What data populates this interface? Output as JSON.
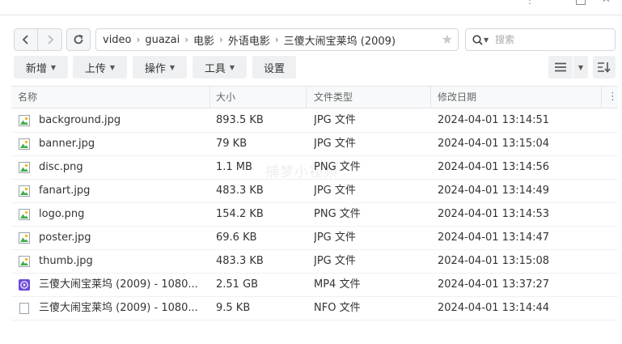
{
  "path": [
    "video",
    "guazai",
    "电影",
    "外语电影",
    "三傻大闹宝莱坞 (2009)"
  ],
  "search": {
    "placeholder": "搜索"
  },
  "toolbar": {
    "new": "新增",
    "upload": "上传",
    "action": "操作",
    "tools": "工具",
    "settings": "设置"
  },
  "columns": {
    "name": "名称",
    "size": "大小",
    "type": "文件类型",
    "modified": "修改日期"
  },
  "files": [
    {
      "name": "background.jpg",
      "size": "893.5 KB",
      "type": "JPG 文件",
      "modified": "2024-04-01 13:14:51",
      "icon": "image-file-icon"
    },
    {
      "name": "banner.jpg",
      "size": "79 KB",
      "type": "JPG 文件",
      "modified": "2024-04-01 13:15:04",
      "icon": "image-file-icon"
    },
    {
      "name": "disc.png",
      "size": "1.1 MB",
      "type": "PNG 文件",
      "modified": "2024-04-01 13:14:56",
      "icon": "image-file-icon"
    },
    {
      "name": "fanart.jpg",
      "size": "483.3 KB",
      "type": "JPG 文件",
      "modified": "2024-04-01 13:14:49",
      "icon": "image-file-icon"
    },
    {
      "name": "logo.png",
      "size": "154.2 KB",
      "type": "PNG 文件",
      "modified": "2024-04-01 13:14:53",
      "icon": "image-file-icon"
    },
    {
      "name": "poster.jpg",
      "size": "69.6 KB",
      "type": "JPG 文件",
      "modified": "2024-04-01 13:14:47",
      "icon": "image-file-icon"
    },
    {
      "name": "thumb.jpg",
      "size": "483.3 KB",
      "type": "JPG 文件",
      "modified": "2024-04-01 13:15:08",
      "icon": "image-file-icon"
    },
    {
      "name": "三傻大闹宝莱坞 (2009) - 1080...",
      "size": "2.51 GB",
      "type": "MP4 文件",
      "modified": "2024-04-01 13:37:27",
      "icon": "video-file-icon"
    },
    {
      "name": "三傻大闹宝莱坞 (2009) - 1080...",
      "size": "9.5 KB",
      "type": "NFO 文件",
      "modified": "2024-04-01 13:14:44",
      "icon": "blank-file-icon"
    }
  ],
  "watermark": "捕梦小视频",
  "colors": {
    "image_icon_green": "#3fae4a",
    "video_icon_purple": "#6c4bd8",
    "border": "#d3d7dc"
  }
}
